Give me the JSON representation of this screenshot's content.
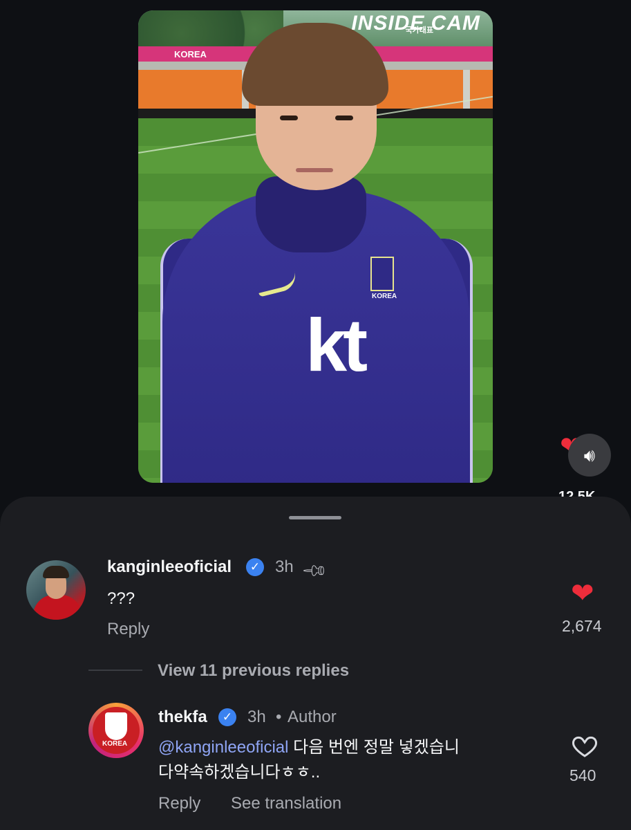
{
  "video": {
    "watermark": "INSIDE CAM",
    "watermark_sub": "국가대표",
    "stadium_banner": "KOREA",
    "jersey_sponsor": "kt",
    "jersey_crest_text": "KOREA"
  },
  "side_actions": {
    "like_count": "12.5K",
    "sound_icon": "speaker-icon"
  },
  "comments": [
    {
      "username": "kanginleeoficial",
      "verified": true,
      "time": "3h",
      "pinned": true,
      "text": "???",
      "reply_label": "Reply",
      "likes": "2,674",
      "liked": true
    },
    {
      "username": "thekfa",
      "verified": true,
      "time": "3h",
      "role": "Author",
      "mention": "@kanginleeoficial",
      "text_line1": " 다음 번엔 정말 넣겠습니",
      "text_line2": "다약속하겠습니다ㅎㅎ..",
      "reply_label": "Reply",
      "translate_label": "See translation",
      "likes": "540",
      "liked": false
    }
  ],
  "view_previous_replies": "View 11 previous replies",
  "colors": {
    "background": "#0e1014",
    "sheet": "#1c1d21",
    "like_red": "#ee2d3b",
    "verified_blue": "#3b82f0",
    "mention_blue": "#8fa5f5"
  }
}
